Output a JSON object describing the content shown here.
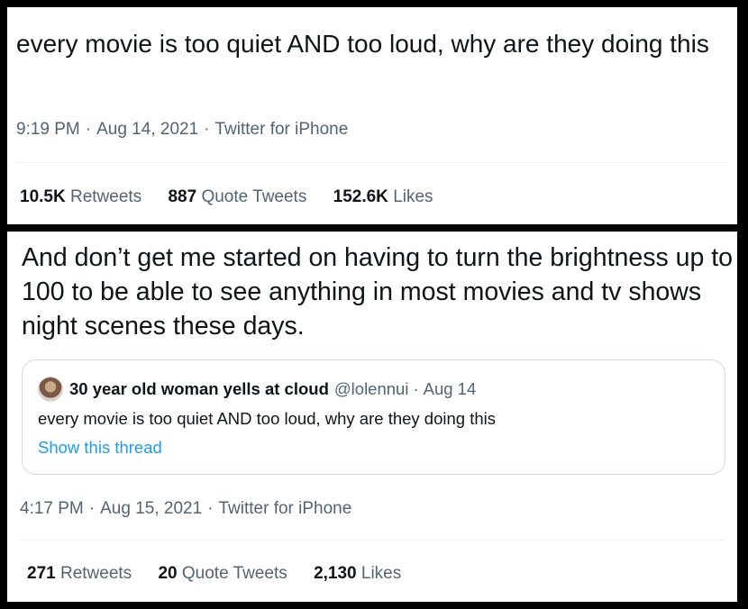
{
  "tweet1": {
    "text": "every movie is too quiet AND too loud, why are they doing this",
    "time": "9:19 PM",
    "date": "Aug 14, 2021",
    "source": "Twitter for iPhone",
    "stats": {
      "retweets_count": "10.5K",
      "retweets_label": "Retweets",
      "quotes_count": "887",
      "quotes_label": "Quote Tweets",
      "likes_count": "152.6K",
      "likes_label": "Likes"
    }
  },
  "tweet2": {
    "text": "And don’t get me started on having to turn the brightness up to 100 to be able to see anything in most movies and tv shows night scenes these days.",
    "quoted": {
      "name": "30 year old woman yells at cloud",
      "handle": "@lolennui",
      "date": "Aug 14",
      "text": "every movie is too quiet AND too loud, why are they doing this",
      "link": "Show this thread"
    },
    "time": "4:17 PM",
    "date": "Aug 15, 2021",
    "source": "Twitter for iPhone",
    "stats": {
      "retweets_count": "271",
      "retweets_label": "Retweets",
      "quotes_count": "20",
      "quotes_label": "Quote Tweets",
      "likes_count": "2,130",
      "likes_label": "Likes"
    }
  },
  "separator": "·",
  "colors": {
    "background": "#000000",
    "panel": "#ffffff",
    "text": "#0f1419",
    "secondary": "#536471",
    "link": "#1d9bf0",
    "border": "#cfd9de"
  }
}
